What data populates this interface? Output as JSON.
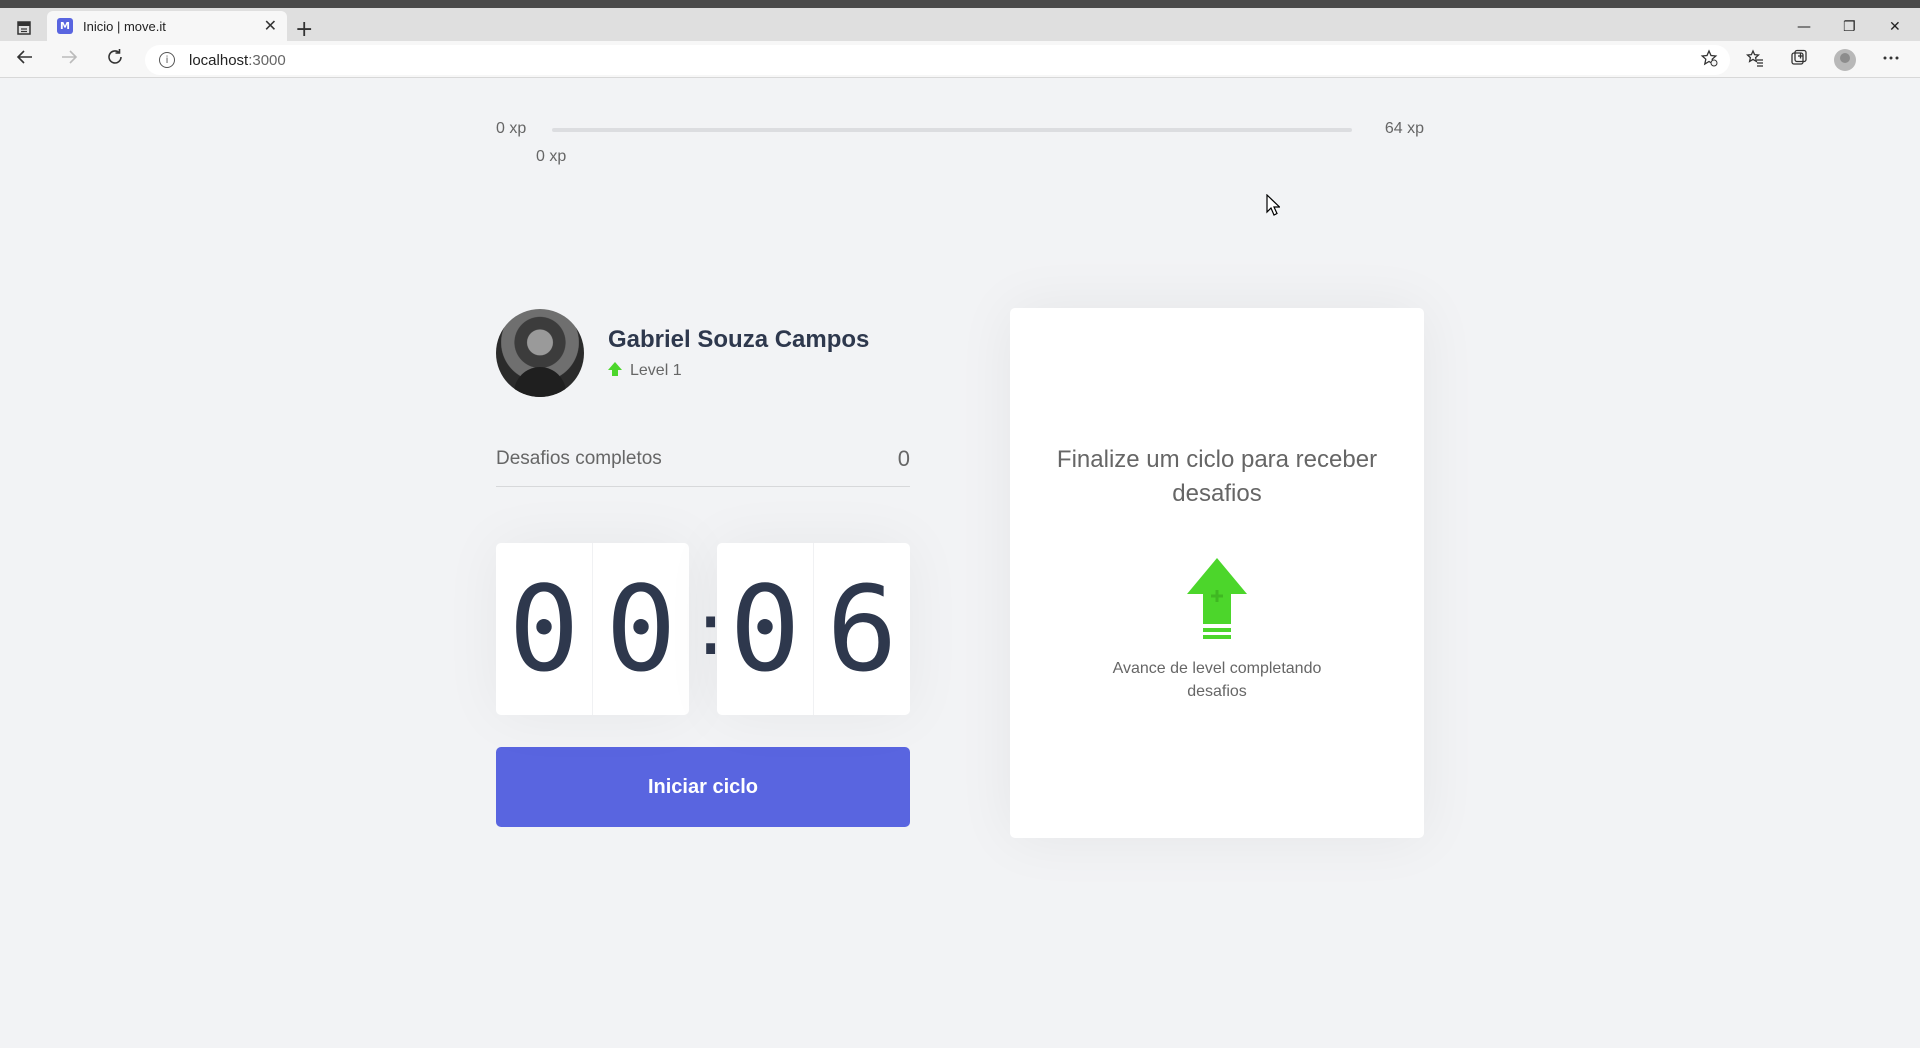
{
  "browser": {
    "tab_title": "Inicio | move.it",
    "favicon_text": "M",
    "tab_close": "✕",
    "new_tab": "+",
    "url_host": "localhost",
    "url_port": ":3000",
    "window_minimize": "—",
    "window_restore": "❐",
    "window_close": "✕"
  },
  "xp": {
    "min_label": "0 xp",
    "max_label": "64 xp",
    "current_label": "0 xp",
    "progress_fraction": 0
  },
  "profile": {
    "name": "Gabriel Souza Campos",
    "level_label": "Level 1"
  },
  "challenges": {
    "label": "Desafios completos",
    "count": "0"
  },
  "countdown": {
    "minute_left": "0",
    "minute_right": "0",
    "separator": ":",
    "second_left": "0",
    "second_right": "6"
  },
  "start_button": {
    "label": "Iniciar ciclo"
  },
  "challenge_box": {
    "title": "Finalize um ciclo para receber desafios",
    "hint": "Avance de level completando desafios"
  },
  "colors": {
    "accent": "#5965e0",
    "level_green": "#4cd62b",
    "title_text": "#2e384d",
    "body_text": "#666666"
  },
  "icons": [
    "tab-actions-icon",
    "back-icon",
    "forward-icon",
    "reload-icon",
    "info-icon",
    "favorite-add-icon",
    "favorites-icon",
    "collections-icon",
    "profile-icon",
    "more-icon",
    "level-up-icon",
    "cursor-icon"
  ]
}
